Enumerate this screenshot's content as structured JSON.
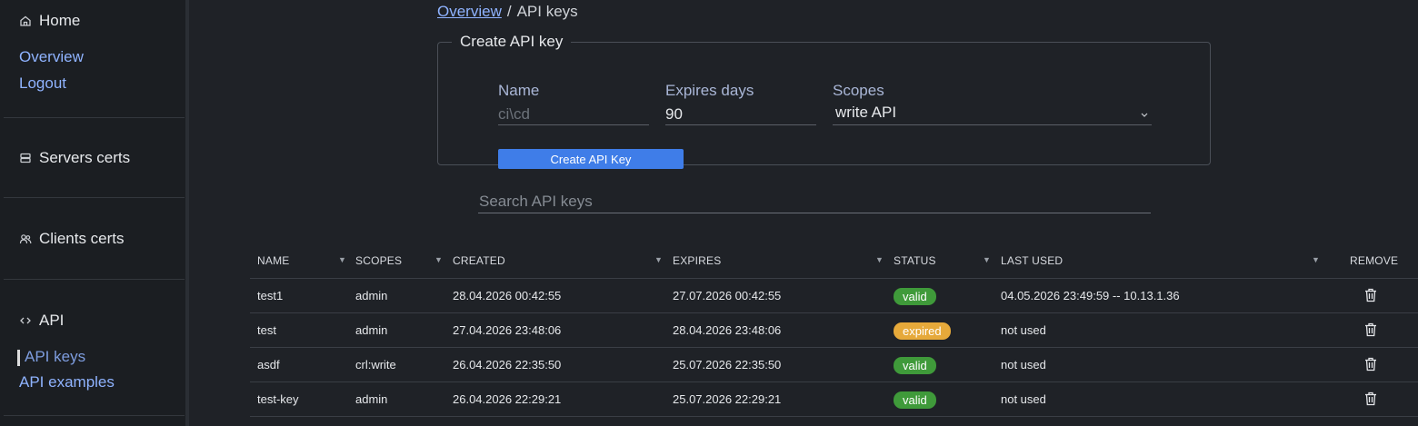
{
  "sidebar": {
    "home": "Home",
    "links_top": [
      "Overview",
      "Logout"
    ],
    "servers": "Servers certs",
    "clients": "Clients certs",
    "api": "API",
    "api_links": [
      "API keys",
      "API examples"
    ]
  },
  "breadcrumb": {
    "parent": "Overview",
    "separator": "/",
    "current": "API keys"
  },
  "create": {
    "legend": "Create API key",
    "name_label": "Name",
    "name_placeholder": "ci\\cd",
    "expires_label": "Expires days",
    "expires_value": "90",
    "scopes_label": "Scopes",
    "scopes_value": "write API",
    "button": "Create API Key"
  },
  "search": {
    "placeholder": "Search API keys"
  },
  "table": {
    "headers": [
      "NAME",
      "SCOPES",
      "CREATED",
      "EXPIRES",
      "STATUS",
      "LAST USED",
      "REMOVE"
    ],
    "rows": [
      {
        "name": "test1",
        "scopes": "admin",
        "created": "28.04.2026 00:42:55",
        "expires": "27.07.2026 00:42:55",
        "status": "valid",
        "last_used": "04.05.2026 23:49:59 -- 10.13.1.36"
      },
      {
        "name": "test",
        "scopes": "admin",
        "created": "27.04.2026 23:48:06",
        "expires": "28.04.2026 23:48:06",
        "status": "expired",
        "last_used": "not used"
      },
      {
        "name": "asdf",
        "scopes": "crl:write",
        "created": "26.04.2026 22:35:50",
        "expires": "25.07.2026 22:35:50",
        "status": "valid",
        "last_used": "not used"
      },
      {
        "name": "test-key",
        "scopes": "admin",
        "created": "26.04.2026 22:29:21",
        "expires": "25.07.2026 22:29:21",
        "status": "valid",
        "last_used": "not used"
      }
    ]
  },
  "colors": {
    "accent": "#3f7de8",
    "link": "#8fb3ff",
    "valid": "#3f9a3a",
    "expired": "#e6a93a"
  },
  "icons": {
    "home": "home-icon",
    "servers": "server-icon",
    "clients": "users-icon",
    "api": "code-icon",
    "remove": "trash-icon",
    "sort": "sort-down-icon",
    "select": "chevron-down-icon"
  }
}
